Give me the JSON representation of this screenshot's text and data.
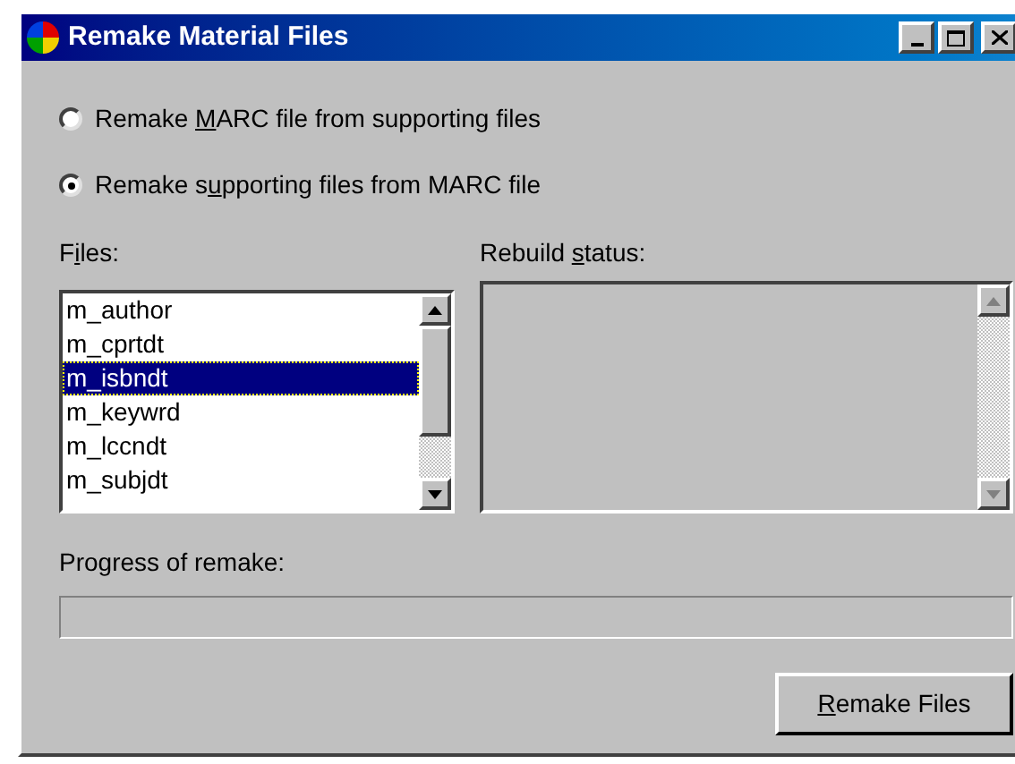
{
  "window": {
    "title": "Remake Material Files"
  },
  "mode_options": [
    {
      "before": "Remake ",
      "key": "M",
      "after": "ARC file from supporting files",
      "selected": false
    },
    {
      "before": "Remake s",
      "key": "u",
      "after": "pporting files from MARC file",
      "selected": true
    }
  ],
  "files": {
    "label": {
      "before": "F",
      "key": "i",
      "after": "les:"
    },
    "items": [
      {
        "name": "m_author",
        "selected": false
      },
      {
        "name": "m_cprtdt",
        "selected": false
      },
      {
        "name": "m_isbndt",
        "selected": true
      },
      {
        "name": "m_keywrd",
        "selected": false
      },
      {
        "name": "m_lccndt",
        "selected": false
      },
      {
        "name": "m_subjdt",
        "selected": false
      }
    ]
  },
  "rebuild_status": {
    "label": {
      "before": "Rebuild ",
      "key": "s",
      "after": "tatus:"
    },
    "disabled": true
  },
  "progress": {
    "label": "Progress of remake:",
    "level": 0
  },
  "remake_button": {
    "key": "R",
    "after": "emake Files"
  }
}
